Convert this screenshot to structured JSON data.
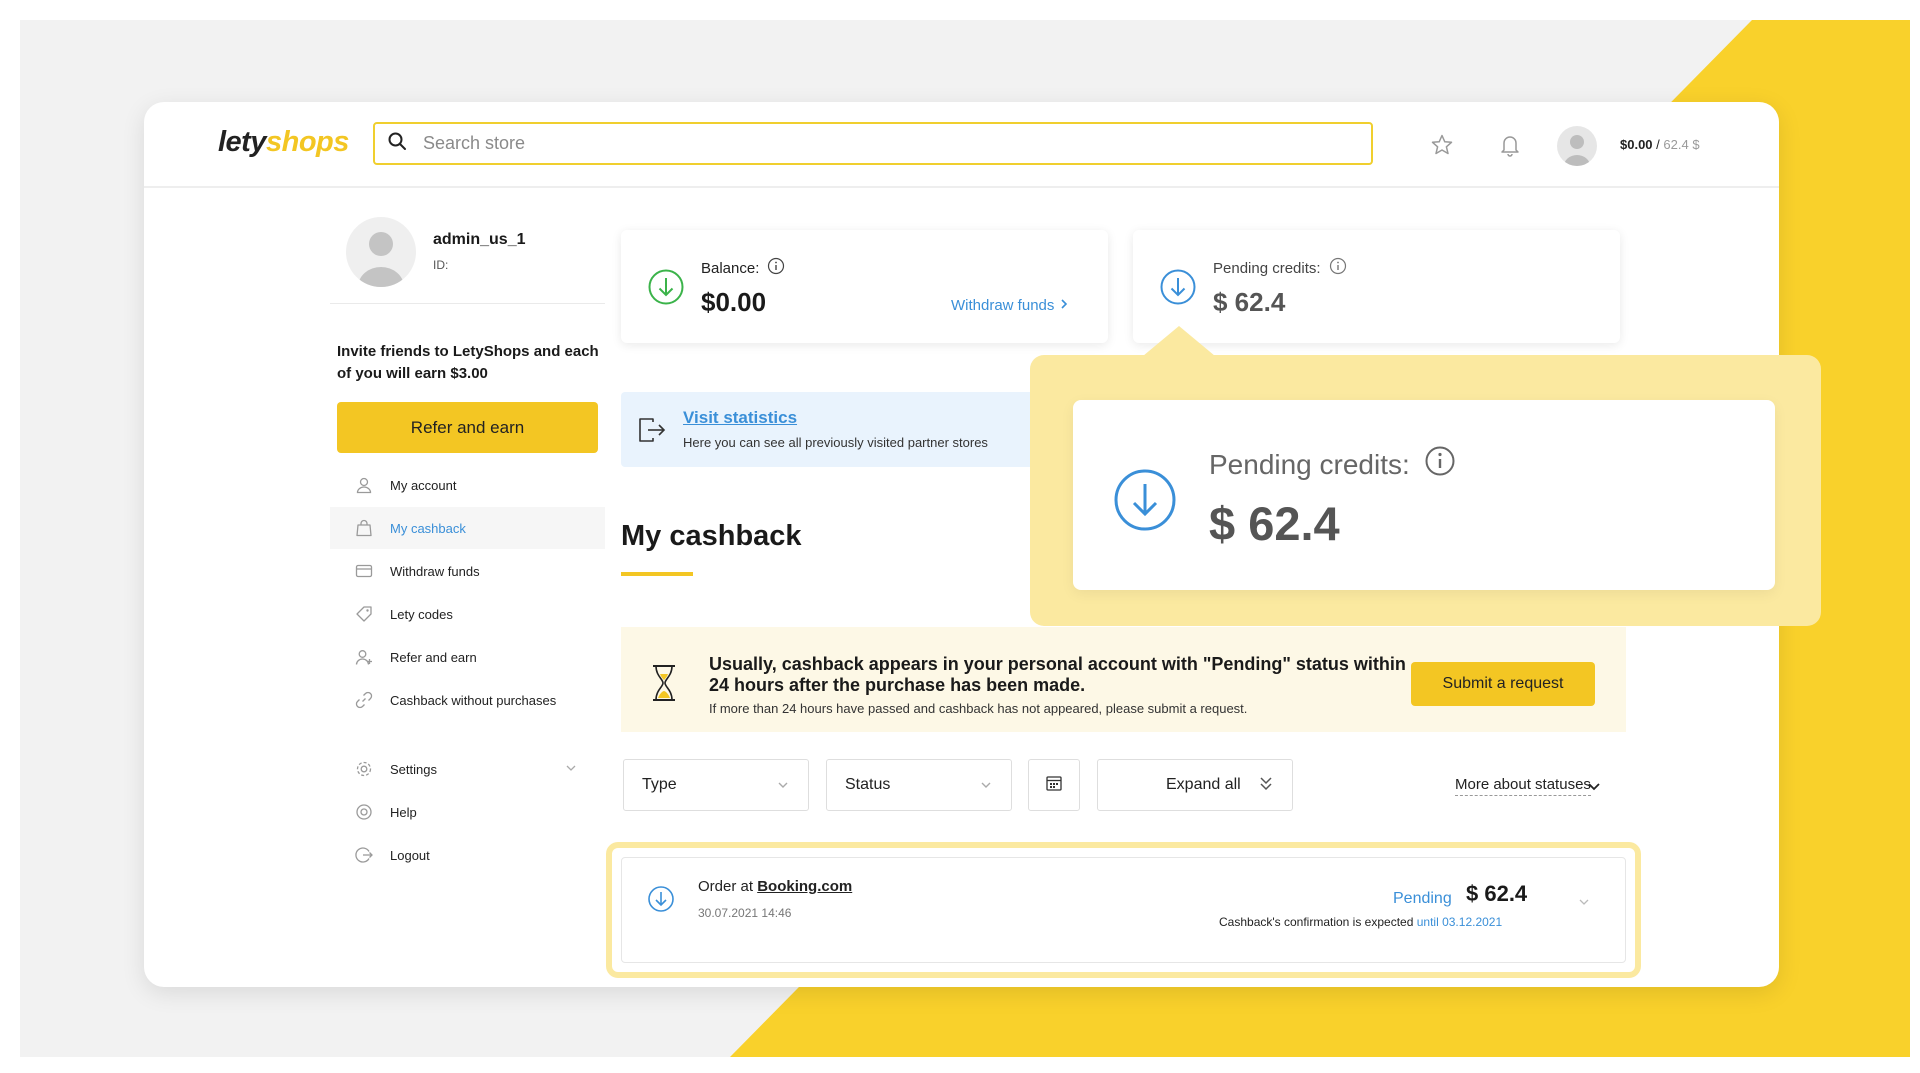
{
  "header": {
    "logo_part1": "lety",
    "logo_part2": "shops",
    "search_placeholder": "Search store",
    "balance_current": "$0.00",
    "balance_separator": "/",
    "balance_pending": "62.4 $",
    "icons": [
      "search-icon",
      "star-icon",
      "bell-icon",
      "avatar"
    ]
  },
  "profile": {
    "name": "admin_us_1",
    "id_label": "ID:"
  },
  "invite": {
    "text": "Invite friends to LetyShops and each of you will earn $3.00",
    "button": "Refer and earn"
  },
  "sidebar": {
    "items": [
      {
        "label": "My account",
        "icon": "user-icon",
        "active": false
      },
      {
        "label": "My cashback",
        "icon": "bag-icon",
        "active": true
      },
      {
        "label": "Withdraw funds",
        "icon": "wallet-icon",
        "active": false
      },
      {
        "label": "Lety codes",
        "icon": "tag-icon",
        "active": false
      },
      {
        "label": "Refer and earn",
        "icon": "add-user-icon",
        "active": false
      },
      {
        "label": "Cashback without purchases",
        "icon": "link-icon",
        "active": false
      }
    ],
    "settings": "Settings",
    "help": "Help",
    "logout": "Logout"
  },
  "balance_card": {
    "label": "Balance:",
    "value": "$0.00",
    "withdraw_link": "Withdraw funds"
  },
  "pending_card": {
    "label": "Pending credits:",
    "value": "$ 62.4"
  },
  "visit": {
    "link": "Visit statistics",
    "subtitle": "Here you can see all previously visited partner stores"
  },
  "main": {
    "title": "My cashback"
  },
  "notice": {
    "title": "Usually, cashback appears in your personal account with \"Pending\" status within 24 hours after the purchase has been made.",
    "subtitle": "If more than 24 hours have passed and cashback has not appeared, please submit a request.",
    "button": "Submit a request"
  },
  "filters": {
    "type": "Type",
    "status": "Status",
    "expand_all": "Expand all",
    "more_statuses": "More about statuses"
  },
  "order": {
    "prefix": "Order at",
    "store": "Booking.com",
    "date": "30.07.2021 14:46",
    "status": "Pending",
    "amount": "$ 62.4",
    "confirm_text": "Cashback's confirmation is expected",
    "confirm_until": "until 03.12.2021"
  },
  "callout": {
    "label": "Pending credits:",
    "value": "$ 62.4"
  },
  "colors": {
    "brand_yellow": "#f3c623",
    "link_blue": "#3a8fd8",
    "callout_bg": "#fbe9a0",
    "balance_green": "#3bb34a"
  }
}
